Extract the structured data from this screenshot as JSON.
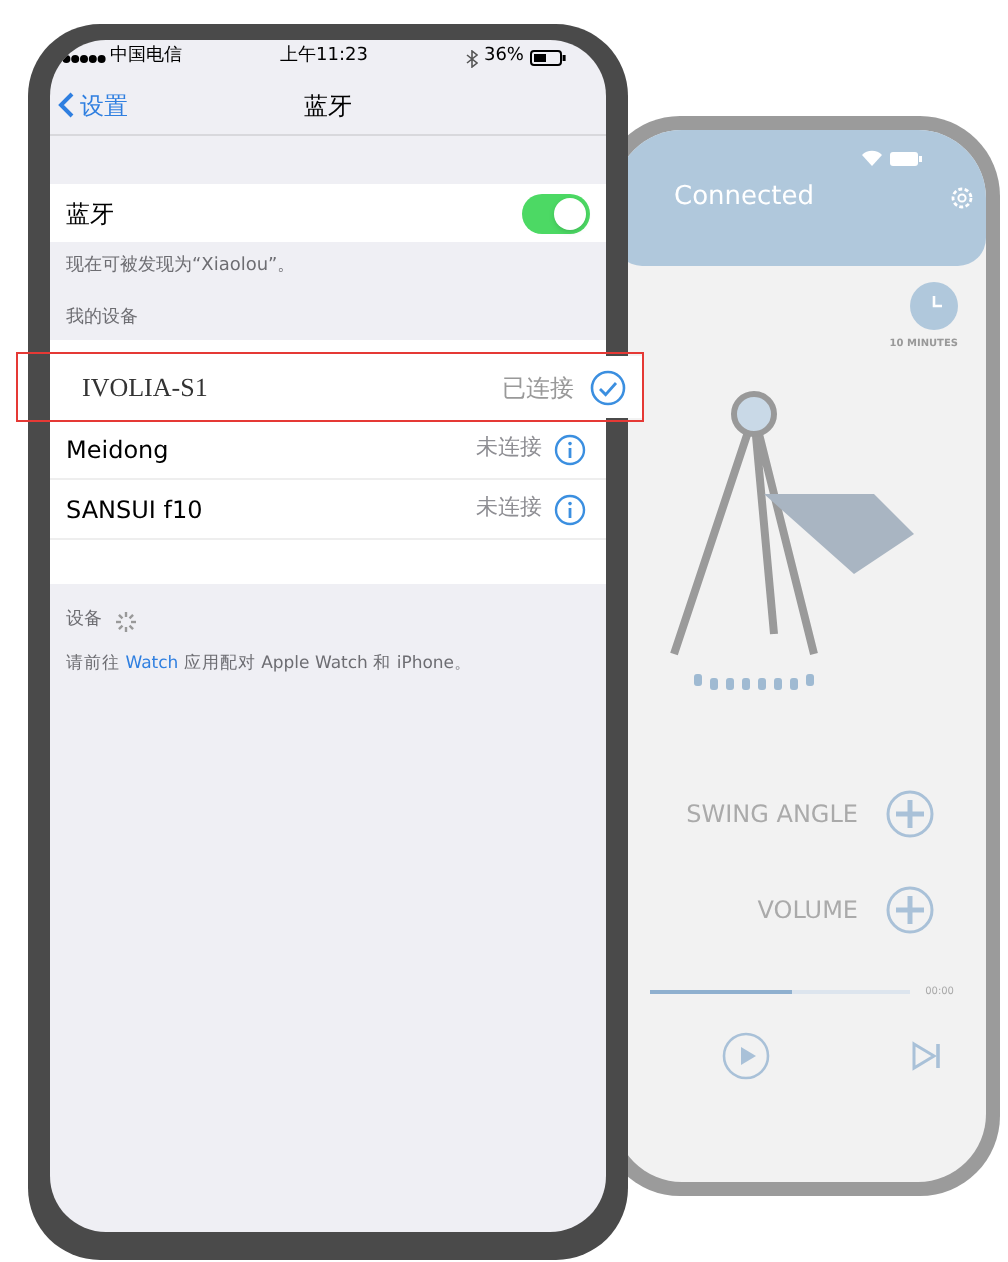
{
  "left_phone": {
    "status_bar": {
      "carrier": "中国电信",
      "time": "上午11:23",
      "battery": "36%"
    },
    "nav": {
      "back": "设置",
      "title": "蓝牙"
    },
    "bluetooth": {
      "label": "蓝牙",
      "on": true
    },
    "discoverable_note": "现在可被发现为“Xiaolou”。",
    "section": "我的设备",
    "devices": [
      {
        "name": "Meidong",
        "status": "未连接",
        "connected": false
      },
      {
        "name": "SANSUI f10",
        "status": "未连接",
        "connected": false
      }
    ],
    "other_devices": "设备",
    "watch_hint": {
      "before": "请前往",
      "link": "Watch",
      "after": "应用配对 Apple Watch 和 iPhone。"
    }
  },
  "highlighted_device": {
    "name": "IVOLIA-S1",
    "status": "已连接",
    "connected": true
  },
  "right_phone": {
    "title": "Connected",
    "timer": "10 MINUTES",
    "controls": [
      {
        "label": "SWING ANGLE"
      },
      {
        "label": "VOLUME"
      }
    ],
    "progress": {
      "level": 0.55,
      "time": "00:00"
    }
  }
}
